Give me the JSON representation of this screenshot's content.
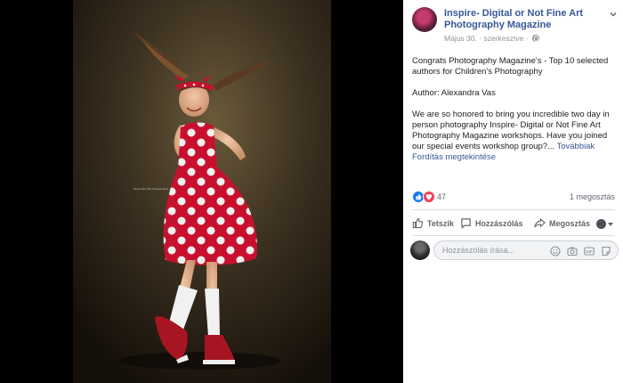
{
  "post": {
    "page_name": "Inspire- Digital or Not Fine Art Photography Magazine",
    "date": "Május 30.",
    "separator": "·",
    "edited": "szerkesztve",
    "paragraphs": [
      "Congrats Photography Magazine's - Top 10 selected authors for Children's Photography",
      "Author: Alexandra Vas",
      "We are so honored to bring you incredible two day in person photography Inspire- Digital or Not Fine Art Photography Magazine workshops. Have you joined our special events workshop group?..."
    ],
    "see_more": "Továbbiak",
    "see_translation": "Fordítás megtekintése",
    "reaction_count": "47",
    "share_count": "1 megosztás"
  },
  "actions": {
    "like": "Tetszik",
    "comment": "Hozzászólás",
    "share": "Megosztás"
  },
  "comment": {
    "placeholder": "Hozzászólás írása..."
  },
  "photo": {
    "signature": "Alexandra Vas Photography"
  },
  "colors": {
    "link": "#385898",
    "secondary_text": "#90949c",
    "like_blue": "#1877f2",
    "love_red": "#f33e58",
    "dress_red": "#c8102e"
  },
  "icons": [
    "globe-icon",
    "chevron-down-icon",
    "like-reaction-icon",
    "love-reaction-icon",
    "thumbs-up-icon",
    "comment-bubble-icon",
    "share-arrow-icon",
    "emoji-icon",
    "camera-icon",
    "gif-icon",
    "sticker-icon"
  ]
}
